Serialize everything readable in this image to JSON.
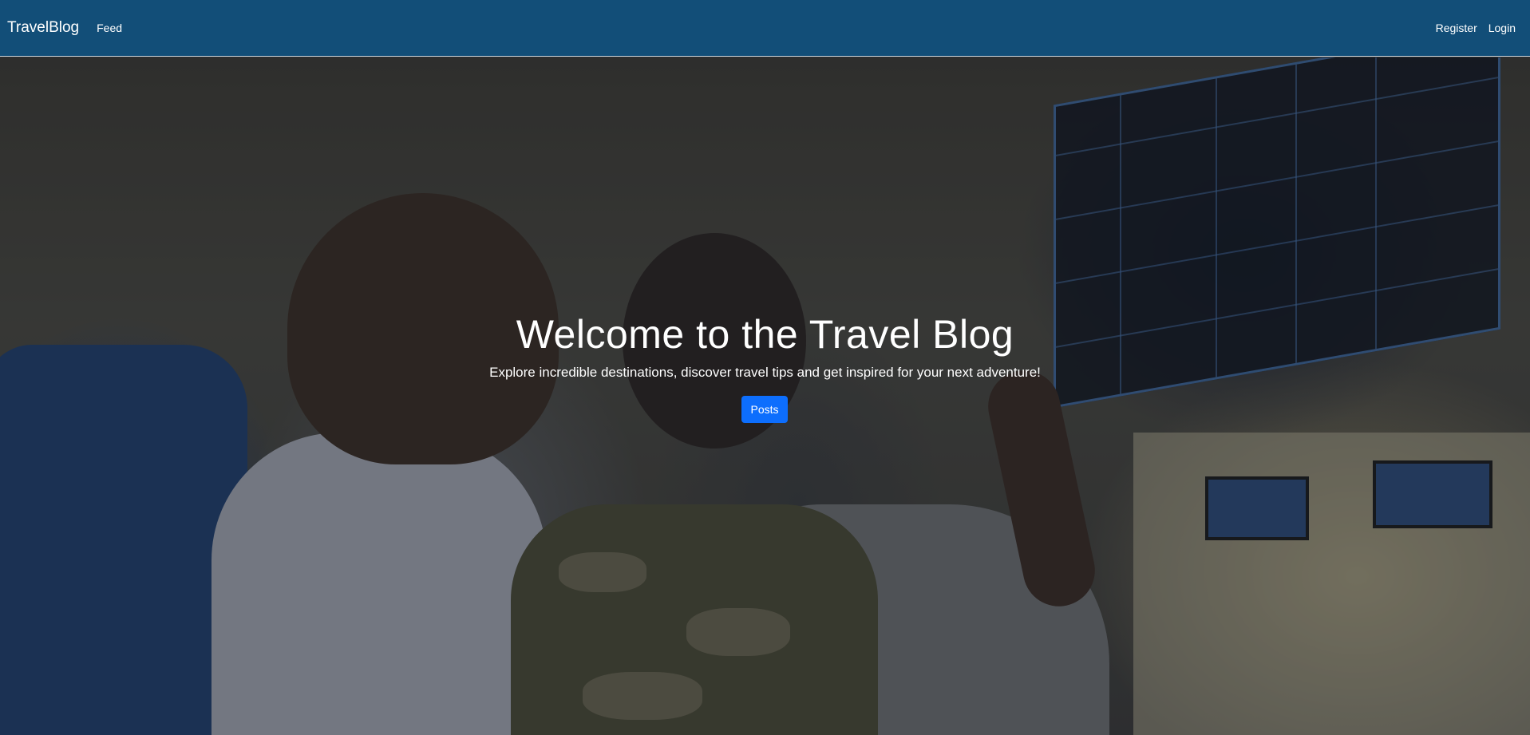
{
  "navbar": {
    "brand": "TravelBlog",
    "links": [
      "Feed"
    ],
    "right_links": [
      "Register",
      "Login"
    ],
    "background_color": "#124e78"
  },
  "hero": {
    "title": "Welcome to the Travel Blog",
    "subtitle": "Explore incredible destinations, discover travel tips and get inspired for your next adventure!",
    "button_label": "Posts",
    "button_color": "#0d6efd"
  }
}
